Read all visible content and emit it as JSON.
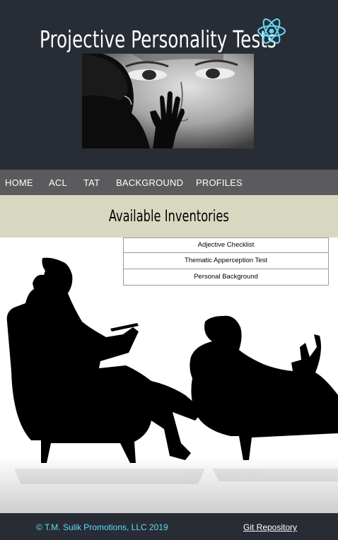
{
  "header": {
    "title": "Projective Personality Tests",
    "logo_icon": "react-atom-icon",
    "hero_image": "woman-behind-glass-photo"
  },
  "nav": {
    "items": [
      {
        "label": "HOME"
      },
      {
        "label": "ACL"
      },
      {
        "label": "TAT"
      },
      {
        "label": "BACKGROUND"
      },
      {
        "label": "PROFILES"
      }
    ]
  },
  "banner": {
    "title": "Available Inventories"
  },
  "inventories": [
    {
      "label": "Adjective Checklist"
    },
    {
      "label": "Thematic Apperception Test"
    },
    {
      "label": "Personal Background"
    }
  ],
  "scene": {
    "image": "therapist-and-patient-silhouette"
  },
  "footer": {
    "copyright": "© T.M. Sulik Promotions, LLC 2019",
    "git_link": "Git Repository"
  },
  "colors": {
    "header_bg": "#282c34",
    "nav_bg": "#5b5b5d",
    "banner_bg": "#d8d8c0",
    "accent": "#61dafb"
  }
}
